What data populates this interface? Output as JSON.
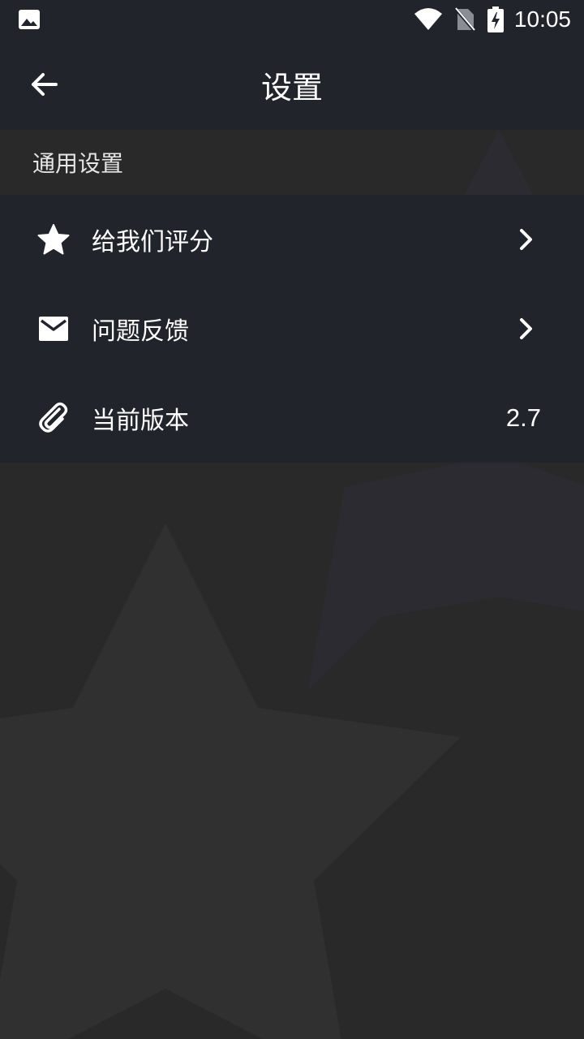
{
  "status_bar": {
    "time": "10:05",
    "icons": [
      "gallery-icon",
      "wifi-icon",
      "no-sim-icon",
      "battery-charging-icon"
    ]
  },
  "app_bar": {
    "title": "设置",
    "back_icon": "arrow-left-icon"
  },
  "section": {
    "title": "通用设置"
  },
  "settings": [
    {
      "icon": "star-icon",
      "label": "给我们评分",
      "trailing": "chevron-right-icon"
    },
    {
      "icon": "mail-icon",
      "label": "问题反馈",
      "trailing": "chevron-right-icon"
    },
    {
      "icon": "paperclip-icon",
      "label": "当前版本",
      "value": "2.7"
    }
  ],
  "colors": {
    "bar_background": "#21242b",
    "page_background": "#292929",
    "text": "#ffffff"
  }
}
